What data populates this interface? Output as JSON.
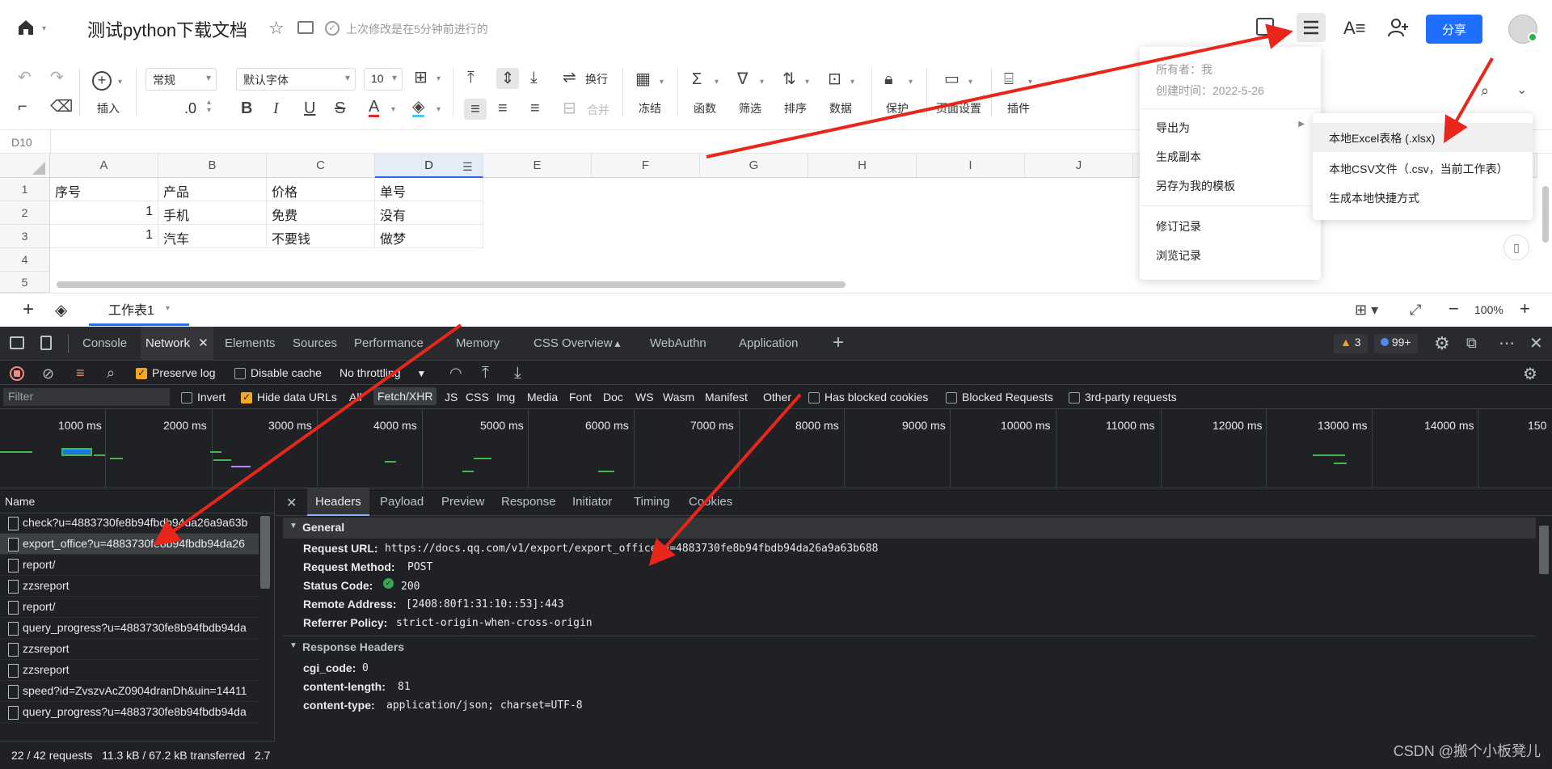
{
  "doc": {
    "title": "测试python下载文档",
    "save_status": "上次修改是在5分钟前进行的",
    "share_label": "分享"
  },
  "toolbar": {
    "insert_label": "插入",
    "number_format": "常规",
    "decimal_label": ".0",
    "font_family": "默认字体",
    "font_size": "10",
    "wrap_label": "换行",
    "merge_label": "合并",
    "freeze_label": "冻结",
    "function_label": "函数",
    "filter_label": "筛选",
    "sort_label": "排序",
    "data_label": "数据",
    "protect_label": "保护",
    "page_setup_label": "页面设置",
    "plugin_label": "插件"
  },
  "formula_bar": {
    "cell_ref": "D10"
  },
  "grid": {
    "columns": [
      "A",
      "B",
      "C",
      "D",
      "E",
      "F",
      "G",
      "H",
      "I",
      "J"
    ],
    "rows": [
      "1",
      "2",
      "3",
      "4",
      "5"
    ],
    "cells": [
      [
        "序号",
        "产品",
        "价格",
        "单号"
      ],
      [
        "1",
        "手机",
        "免费",
        "没有"
      ],
      [
        "1",
        "汽车",
        "不要钱",
        "做梦"
      ]
    ]
  },
  "sheetbar": {
    "sheet_name": "工作表1",
    "zoom": "100%"
  },
  "menu": {
    "owner": "所有者：我",
    "created": "创建时间：2022-5-26",
    "items": [
      "导出为",
      "生成副本",
      "另存为我的模板",
      "修订记录",
      "浏览记录"
    ],
    "submenu": [
      "本地Excel表格 (.xlsx)",
      "本地CSV文件（.csv，当前工作表）",
      "生成本地快捷方式"
    ]
  },
  "devtools": {
    "tabs": [
      "Console",
      "Network",
      "Elements",
      "Sources",
      "Performance",
      "Memory",
      "CSS Overview",
      "WebAuthn",
      "Application"
    ],
    "warn_count": "3",
    "issue_count": "99+",
    "preserve_log": "Preserve log",
    "disable_cache": "Disable cache",
    "throttling": "No throttling",
    "filter_placeholder": "Filter",
    "invert": "Invert",
    "hide_data_urls": "Hide data URLs",
    "type_filters": [
      "All",
      "Fetch/XHR",
      "JS",
      "CSS",
      "Img",
      "Media",
      "Font",
      "Doc",
      "WS",
      "Wasm",
      "Manifest",
      "Other"
    ],
    "has_blocked_cookies": "Has blocked cookies",
    "blocked_requests": "Blocked Requests",
    "third_party": "3rd-party requests",
    "ticks": [
      "1000 ms",
      "2000 ms",
      "3000 ms",
      "4000 ms",
      "5000 ms",
      "6000 ms",
      "7000 ms",
      "8000 ms",
      "9000 ms",
      "10000 ms",
      "11000 ms",
      "12000 ms",
      "13000 ms",
      "14000 ms",
      "150"
    ],
    "name_header": "Name",
    "requests": [
      "check?u=4883730fe8b94fbdb94da26a9a63b",
      "export_office?u=4883730fe8b94fbdb94da26",
      "report/",
      "zzsreport",
      "report/",
      "query_progress?u=4883730fe8b94fbdb94da",
      "zzsreport",
      "zzsreport",
      "speed?id=ZvszvAcZ0904dranDh&uin=14411",
      "query_progress?u=4883730fe8b94fbdb94da"
    ],
    "status_bar": "22 / 42 requests   11.3 kB / 67.2 kB transferred   2.7",
    "detail_tabs": [
      "Headers",
      "Payload",
      "Preview",
      "Response",
      "Initiator",
      "Timing",
      "Cookies"
    ],
    "general_title": "General",
    "general": [
      {
        "key": "Request URL:",
        "value": "https://docs.qq.com/v1/export/export_office?u=4883730fe8b94fbdb94da26a9a63b688"
      },
      {
        "key": "Request Method:",
        "value": "POST"
      },
      {
        "key": "Status Code:",
        "value": "200"
      },
      {
        "key": "Remote Address:",
        "value": "[2408:80f1:31:10::53]:443"
      },
      {
        "key": "Referrer Policy:",
        "value": "strict-origin-when-cross-origin"
      }
    ],
    "response_title": "Response Headers",
    "response": [
      {
        "key": "cgi_code:",
        "value": "0"
      },
      {
        "key": "content-length:",
        "value": "81"
      },
      {
        "key": "content-type:",
        "value": "application/json; charset=UTF-8"
      }
    ]
  },
  "watermark": "CSDN @搬个小板凳儿",
  "colors": {
    "accent": "#1e6fff",
    "arrow": "#e8261c",
    "devtools_bg": "#202124"
  }
}
